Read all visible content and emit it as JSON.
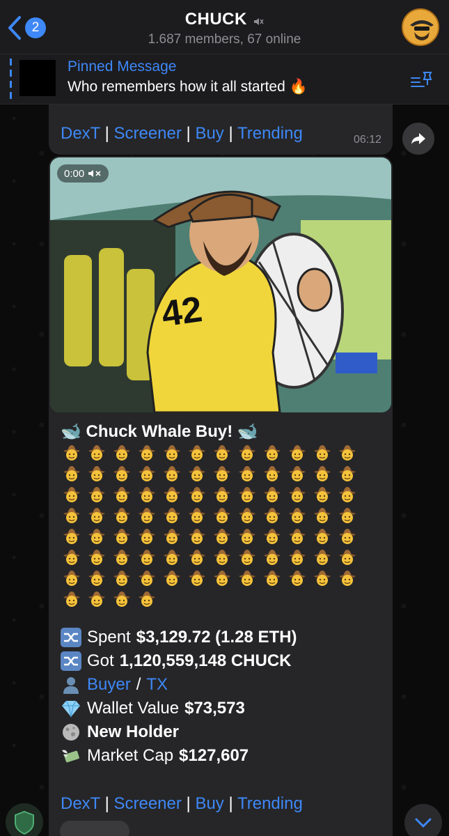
{
  "header": {
    "back_count": "2",
    "title": "CHUCK",
    "subtitle": "1.687 members, 67 online"
  },
  "pinned": {
    "label": "Pinned Message",
    "text": "Who remembers how it all started 🔥"
  },
  "message": {
    "links": [
      "DexT",
      "Screener",
      "Buy",
      "Trending"
    ],
    "separator": "|",
    "time": "06:12",
    "video": {
      "duration": "0:00"
    },
    "headline": "🐋 Chuck Whale Buy! 🐋",
    "cowboy_count": 88,
    "stats": {
      "spent_label": "Spent",
      "spent_value": "$3,129.72 (1.28 ETH)",
      "got_label": "Got",
      "got_value": "1,120,559,148 CHUCK",
      "buyer_link": "Buyer",
      "slash": "/",
      "tx_link": "TX",
      "wallet_label": "Wallet Value",
      "wallet_value": "$73,573",
      "holder_value": "New Holder",
      "mcap_label": "Market Cap",
      "mcap_value": "$127,607"
    }
  },
  "colors": {
    "accent": "#3e88f7",
    "bubble": "#262628",
    "header": "#1c1c1e"
  }
}
